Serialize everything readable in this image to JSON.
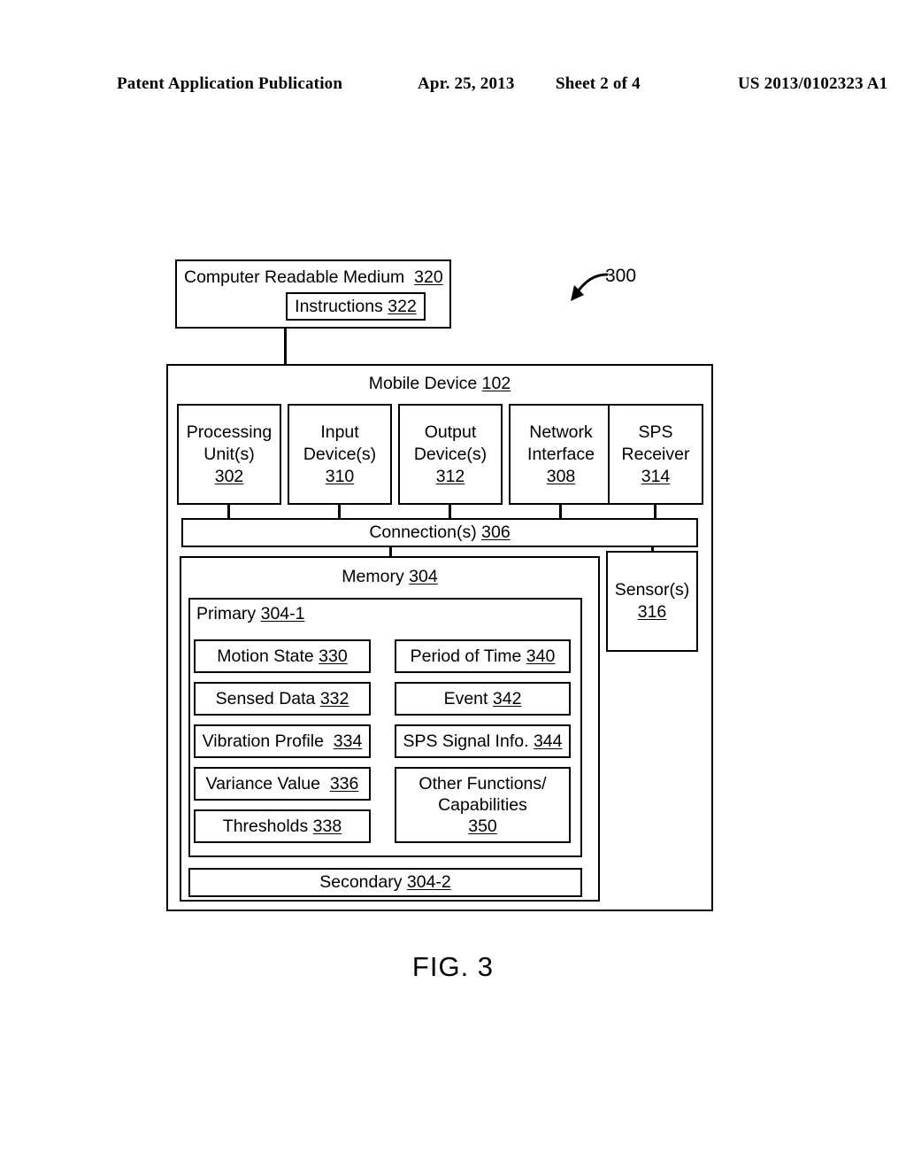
{
  "page_header": {
    "publication": "Patent Application Publication",
    "date": "Apr. 25, 2013",
    "sheet": "Sheet 2 of 4",
    "patent_number": "US 2013/0102323 A1"
  },
  "figure": {
    "caption": "FIG. 3",
    "reference_numeral": "300",
    "crm": {
      "title": "Computer Readable Medium",
      "title_ref": "320",
      "instructions_label": "Instructions",
      "instructions_ref": "322"
    },
    "mobile_device": {
      "title": "Mobile Device",
      "title_ref": "102",
      "components": [
        {
          "line1": "Processing",
          "line2": "Unit(s)",
          "ref": "302"
        },
        {
          "line1": "Input",
          "line2": "Device(s)",
          "ref": "310"
        },
        {
          "line1": "Output",
          "line2": "Device(s)",
          "ref": "312"
        },
        {
          "line1": "Network",
          "line2": "Interface",
          "ref": "308"
        },
        {
          "line1": "SPS",
          "line2": "Receiver",
          "ref": "314"
        }
      ],
      "connections": {
        "label": "Connection(s)",
        "ref": "306"
      },
      "sensors": {
        "line1": "Sensor(s)",
        "ref": "316"
      },
      "memory": {
        "title": "Memory",
        "title_ref": "304",
        "primary": {
          "label": "Primary",
          "ref": "304-1"
        },
        "secondary": {
          "label": "Secondary",
          "ref": "304-2"
        },
        "left_items": [
          {
            "label": "Motion State",
            "ref": "330"
          },
          {
            "label": "Sensed Data",
            "ref": "332"
          },
          {
            "label": "Vibration Profile",
            "ref": "334"
          },
          {
            "label": "Variance Value",
            "ref": "336"
          },
          {
            "label": "Thresholds",
            "ref": "338"
          }
        ],
        "right_items": [
          {
            "label": "Period of Time",
            "ref": "340"
          },
          {
            "label": "Event",
            "ref": "342"
          },
          {
            "label": "SPS Signal Info.",
            "ref": "344"
          },
          {
            "line1": "Other Functions/",
            "line2": "Capabilities",
            "ref": "350"
          }
        ]
      }
    }
  }
}
